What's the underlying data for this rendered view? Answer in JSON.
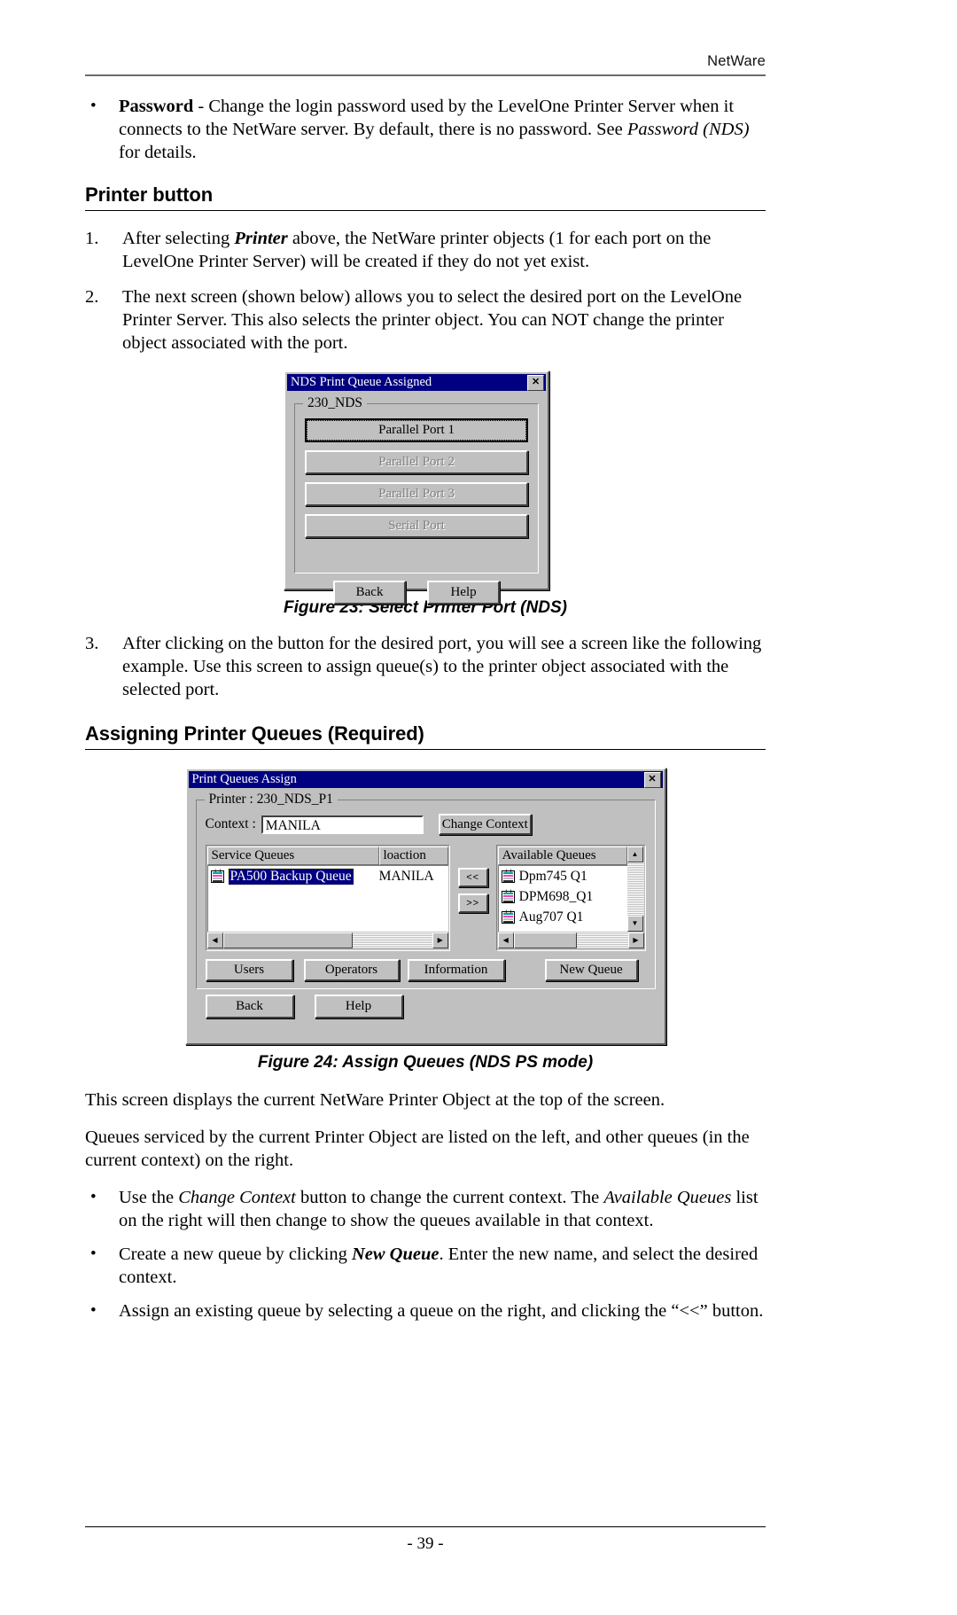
{
  "header": {
    "running_head": "NetWare"
  },
  "footer": {
    "page_number": "- 39 -"
  },
  "intro_bullet": {
    "bullet_char": "•",
    "term": "Password",
    "text_1": " - Change the login password used by the LevelOne Printer Server when it connects to the NetWare server. By default, there is no password. See ",
    "ref_italic": "Password (NDS)",
    "text_2": " for details."
  },
  "section_printer_button": {
    "heading": "Printer button"
  },
  "list_items": [
    {
      "num": "1.",
      "text_1": "After selecting ",
      "emph": "Printer",
      "text_2": " above, the NetWare printer objects (1 for each port on the LevelOne Printer Server) will be created if they do not yet exist."
    },
    {
      "num": "2.",
      "text_1": "The next screen (shown below) allows you to select the desired port on the LevelOne Printer Server. This also selects the printer object. You can NOT change the printer object associated with the port.",
      "emph": "",
      "text_2": ""
    },
    {
      "num": "3.",
      "text_1": "After clicking on the button for the desired port, you will see a screen like the following example. Use this screen to assign queue(s) to the printer object associated with the selected port.",
      "emph": "",
      "text_2": ""
    }
  ],
  "figure23": {
    "caption": "Figure 23: Select Printer Port (NDS)",
    "dialog": {
      "title": "NDS Print Queue Assigned",
      "close_label": "✕",
      "group_legend": "230_NDS",
      "ports": [
        {
          "label": "Parallel Port 1",
          "state": "selected"
        },
        {
          "label": "Parallel Port 2",
          "state": "disabled"
        },
        {
          "label": "Parallel Port 3",
          "state": "disabled"
        },
        {
          "label": "Serial Port",
          "state": "disabled"
        }
      ],
      "buttons": [
        {
          "label": "Back"
        },
        {
          "label": "Help"
        }
      ]
    }
  },
  "section_assign_queues": {
    "heading": "Assigning Printer Queues (Required)"
  },
  "figure24": {
    "caption": "Figure 24: Assign Queues (NDS PS mode)",
    "dialog": {
      "title": "Print Queues Assign",
      "close_label": "✕",
      "group_legend": "Printer : 230_NDS_P1",
      "context_label": "Context :",
      "context_value": "MANILA",
      "change_context_button": "Change Context",
      "service_queues": {
        "col_name": "Service Queues",
        "col_location": "loaction",
        "rows": [
          {
            "name": "PA500 Backup Queue",
            "location": "MANILA",
            "selected": true
          }
        ]
      },
      "transfer_buttons": [
        {
          "label": "<<"
        },
        {
          "label": ">>"
        }
      ],
      "available_queues": {
        "col_name": "Available Queues",
        "rows": [
          {
            "name": "Dpm745 Q1"
          },
          {
            "name": "DPM698_Q1"
          },
          {
            "name": "Aug707 Q1"
          }
        ]
      },
      "action_buttons": [
        {
          "label": "Users"
        },
        {
          "label": "Operators"
        },
        {
          "label": "Information"
        },
        {
          "label": "New Queue"
        }
      ],
      "bottom_buttons": [
        {
          "label": "Back"
        },
        {
          "label": "Help"
        }
      ]
    }
  },
  "closing_paragraphs": [
    "This screen displays the current NetWare Printer Object at the top of the screen.",
    "Queues serviced by the current Printer Object are listed on the left, and other queues (in the current context) on the right."
  ],
  "closing_bullets": [
    {
      "bullet_char": "•",
      "text_1": "Use the ",
      "emph": "Change Context",
      "emph_style": "italic",
      "text_2": " button to change the current context. The ",
      "emph2": "Available Queues",
      "text_3": " list on the right will then change to show the queues available in that context."
    },
    {
      "bullet_char": "•",
      "text_1": "Create a new queue by clicking ",
      "emph": "New Queue",
      "emph_style": "bold-italic",
      "text_2": ". Enter the new name, and select the desired context.",
      "emph2": "",
      "text_3": ""
    },
    {
      "bullet_char": "•",
      "text_1": "Assign an existing queue by selecting a queue on the right, and clicking the “<<” button.",
      "emph": "",
      "emph_style": "none",
      "text_2": "",
      "emph2": "",
      "text_3": ""
    }
  ]
}
